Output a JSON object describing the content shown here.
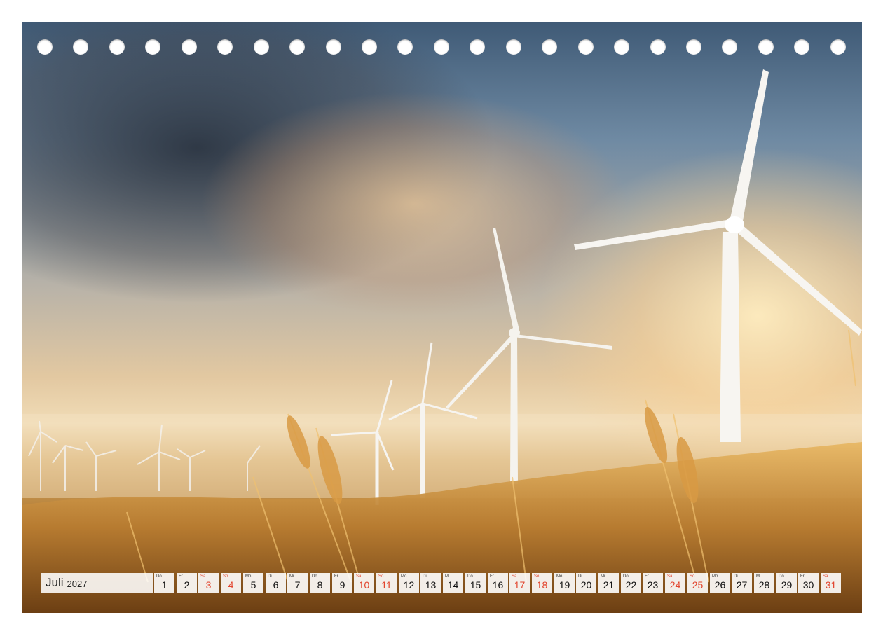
{
  "calendar": {
    "month": "Juli",
    "year": "2027",
    "days": [
      {
        "wd": "Do",
        "d": "1",
        "weekend": false
      },
      {
        "wd": "Fr",
        "d": "2",
        "weekend": false
      },
      {
        "wd": "Sa",
        "d": "3",
        "weekend": true
      },
      {
        "wd": "So",
        "d": "4",
        "weekend": true
      },
      {
        "wd": "Mo",
        "d": "5",
        "weekend": false
      },
      {
        "wd": "Di",
        "d": "6",
        "weekend": false
      },
      {
        "wd": "Mi",
        "d": "7",
        "weekend": false
      },
      {
        "wd": "Do",
        "d": "8",
        "weekend": false
      },
      {
        "wd": "Fr",
        "d": "9",
        "weekend": false
      },
      {
        "wd": "Sa",
        "d": "10",
        "weekend": true
      },
      {
        "wd": "So",
        "d": "11",
        "weekend": true
      },
      {
        "wd": "Mo",
        "d": "12",
        "weekend": false
      },
      {
        "wd": "Di",
        "d": "13",
        "weekend": false
      },
      {
        "wd": "Mi",
        "d": "14",
        "weekend": false
      },
      {
        "wd": "Do",
        "d": "15",
        "weekend": false
      },
      {
        "wd": "Fr",
        "d": "16",
        "weekend": false
      },
      {
        "wd": "Sa",
        "d": "17",
        "weekend": true
      },
      {
        "wd": "So",
        "d": "18",
        "weekend": true
      },
      {
        "wd": "Mo",
        "d": "19",
        "weekend": false
      },
      {
        "wd": "Di",
        "d": "20",
        "weekend": false
      },
      {
        "wd": "Mi",
        "d": "21",
        "weekend": false
      },
      {
        "wd": "Do",
        "d": "22",
        "weekend": false
      },
      {
        "wd": "Fr",
        "d": "23",
        "weekend": false
      },
      {
        "wd": "Sa",
        "d": "24",
        "weekend": true
      },
      {
        "wd": "So",
        "d": "25",
        "weekend": true
      },
      {
        "wd": "Mo",
        "d": "26",
        "weekend": false
      },
      {
        "wd": "Di",
        "d": "27",
        "weekend": false
      },
      {
        "wd": "Mi",
        "d": "28",
        "weekend": false
      },
      {
        "wd": "Do",
        "d": "29",
        "weekend": false
      },
      {
        "wd": "Fr",
        "d": "30",
        "weekend": false
      },
      {
        "wd": "Sa",
        "d": "31",
        "weekend": true
      }
    ]
  },
  "colors": {
    "weekend": "#e2452e",
    "cell_background": "#ffffff"
  }
}
